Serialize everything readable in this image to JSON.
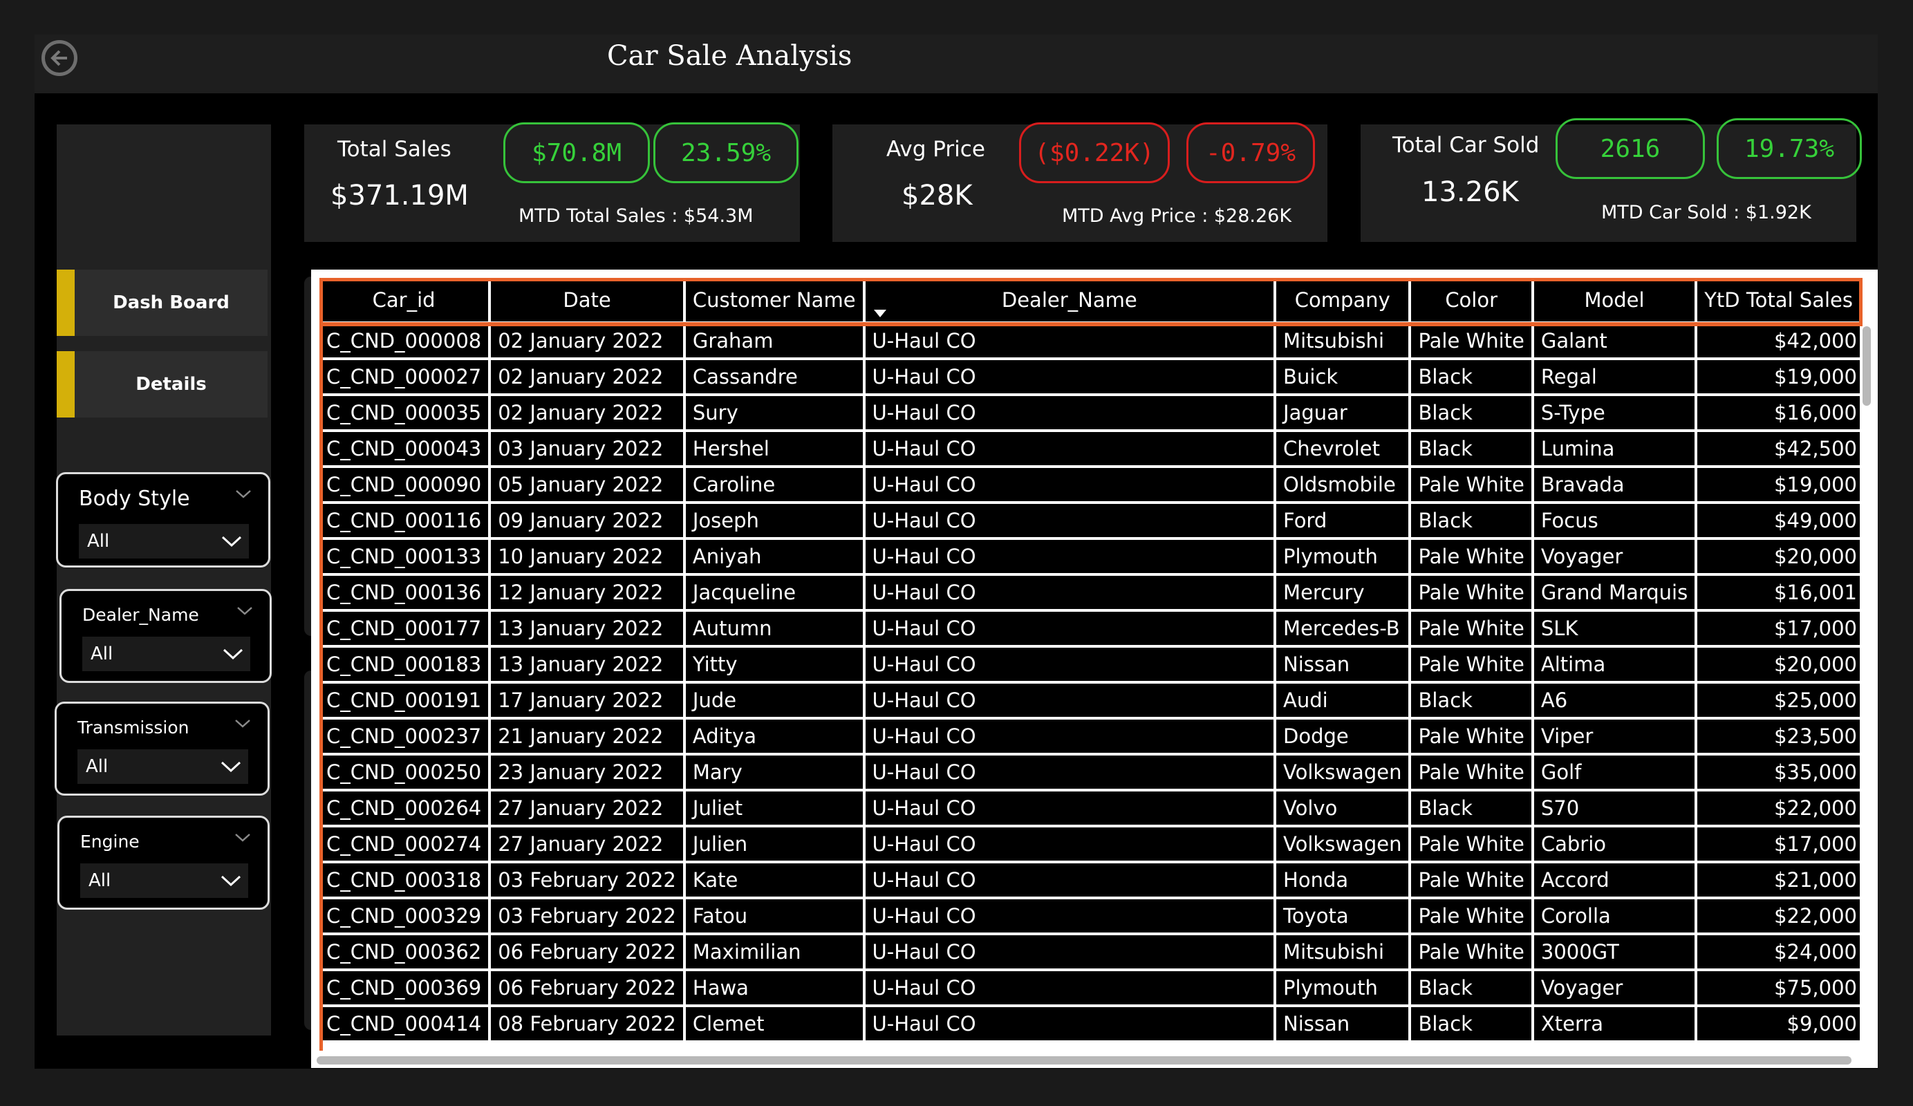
{
  "header": {
    "title": "Car Sale Analysis"
  },
  "sidebar": {
    "nav": [
      {
        "label": "Dash Board"
      },
      {
        "label": "Details"
      }
    ],
    "slicers": [
      {
        "title": "Body Style",
        "value": "All"
      },
      {
        "title": "Dealer_Name",
        "value": "All"
      },
      {
        "title": "Transmission",
        "value": "All"
      },
      {
        "title": "Engine",
        "value": "All"
      }
    ]
  },
  "kpis": [
    {
      "label": "Total Sales",
      "value": "$371.19M",
      "pill1": "$70.8M",
      "pill2": "23.59%",
      "mtd": "MTD Total Sales : $54.3M",
      "trend": "positive"
    },
    {
      "label": "Avg Price",
      "value": "$28K",
      "pill1": "($0.22K)",
      "pill2": "-0.79%",
      "mtd": "MTD Avg Price : $28.26K",
      "trend": "negative"
    },
    {
      "label": "Total Car Sold",
      "value": "13.26K",
      "pill1": "2616",
      "pill2": "19.73%",
      "mtd": "MTD Car Sold : $1.92K",
      "trend": "positive"
    }
  ],
  "colors": {
    "positive": "#36d13a",
    "negative": "#e2261f",
    "accent": "#d4b00a",
    "table_highlight": "#e8622a"
  },
  "icons": {
    "back": "back-arrow-icon",
    "chevron": "chevron-down-icon",
    "sort": "sort-descending-icon"
  },
  "table": {
    "columns": [
      "Car_id",
      "Date",
      "Customer Name",
      "Dealer_Name",
      "Company",
      "Color",
      "Model",
      "YtD Total Sales"
    ],
    "sorted_column": "Dealer_Name",
    "rows": [
      [
        "C_CND_000008",
        "02 January 2022",
        "Graham",
        "U-Haul CO",
        "Mitsubishi",
        "Pale White",
        "Galant",
        "$42,000"
      ],
      [
        "C_CND_000027",
        "02 January 2022",
        "Cassandre",
        "U-Haul CO",
        "Buick",
        "Black",
        "Regal",
        "$19,000"
      ],
      [
        "C_CND_000035",
        "02 January 2022",
        "Sury",
        "U-Haul CO",
        "Jaguar",
        "Black",
        "S-Type",
        "$16,000"
      ],
      [
        "C_CND_000043",
        "03 January 2022",
        "Hershel",
        "U-Haul CO",
        "Chevrolet",
        "Black",
        "Lumina",
        "$42,500"
      ],
      [
        "C_CND_000090",
        "05 January 2022",
        "Caroline",
        "U-Haul CO",
        "Oldsmobile",
        "Pale White",
        "Bravada",
        "$19,000"
      ],
      [
        "C_CND_000116",
        "09 January 2022",
        "Joseph",
        "U-Haul CO",
        "Ford",
        "Black",
        "Focus",
        "$49,000"
      ],
      [
        "C_CND_000133",
        "10 January 2022",
        "Aniyah",
        "U-Haul CO",
        "Plymouth",
        "Pale White",
        "Voyager",
        "$20,000"
      ],
      [
        "C_CND_000136",
        "12 January 2022",
        "Jacqueline",
        "U-Haul CO",
        "Mercury",
        "Pale White",
        "Grand Marquis",
        "$16,001"
      ],
      [
        "C_CND_000177",
        "13 January 2022",
        "Autumn",
        "U-Haul CO",
        "Mercedes-B",
        "Pale White",
        "SLK",
        "$17,000"
      ],
      [
        "C_CND_000183",
        "13 January 2022",
        "Yitty",
        "U-Haul CO",
        "Nissan",
        "Pale White",
        "Altima",
        "$20,000"
      ],
      [
        "C_CND_000191",
        "17 January 2022",
        "Jude",
        "U-Haul CO",
        "Audi",
        "Black",
        "A6",
        "$25,000"
      ],
      [
        "C_CND_000237",
        "21 January 2022",
        "Aditya",
        "U-Haul CO",
        "Dodge",
        "Pale White",
        "Viper",
        "$23,500"
      ],
      [
        "C_CND_000250",
        "23 January 2022",
        "Mary",
        "U-Haul CO",
        "Volkswagen",
        "Pale White",
        "Golf",
        "$35,000"
      ],
      [
        "C_CND_000264",
        "27 January 2022",
        "Juliet",
        "U-Haul CO",
        "Volvo",
        "Black",
        "S70",
        "$22,000"
      ],
      [
        "C_CND_000274",
        "27 January 2022",
        "Julien",
        "U-Haul CO",
        "Volkswagen",
        "Pale White",
        "Cabrio",
        "$17,000"
      ],
      [
        "C_CND_000318",
        "03 February 2022",
        "Kate",
        "U-Haul CO",
        "Honda",
        "Pale White",
        "Accord",
        "$21,000"
      ],
      [
        "C_CND_000329",
        "03 February 2022",
        "Fatou",
        "U-Haul CO",
        "Toyota",
        "Pale White",
        "Corolla",
        "$22,000"
      ],
      [
        "C_CND_000362",
        "06 February 2022",
        "Maximilian",
        "U-Haul CO",
        "Mitsubishi",
        "Pale White",
        "3000GT",
        "$24,000"
      ],
      [
        "C_CND_000369",
        "06 February 2022",
        "Hawa",
        "U-Haul CO",
        "Plymouth",
        "Black",
        "Voyager",
        "$75,000"
      ],
      [
        "C_CND_000414",
        "08 February 2022",
        "Clemet",
        "U-Haul CO",
        "Nissan",
        "Black",
        "Xterra",
        "$9,000"
      ]
    ]
  }
}
